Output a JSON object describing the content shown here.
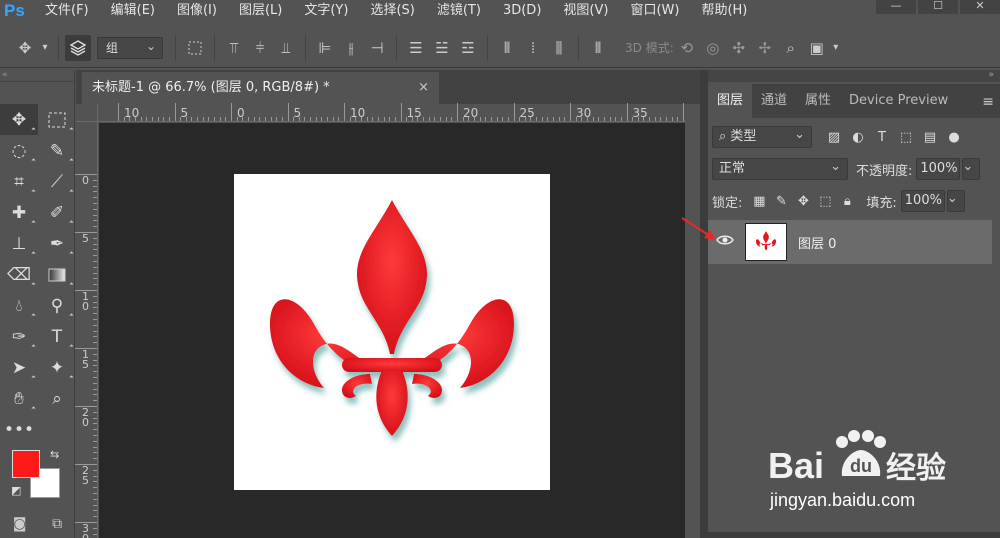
{
  "app": {
    "logo": "Ps",
    "menu": [
      "文件(F)",
      "编辑(E)",
      "图像(I)",
      "图层(L)",
      "文字(Y)",
      "选择(S)",
      "滤镜(T)",
      "3D(D)",
      "视图(V)",
      "窗口(W)",
      "帮助(H)"
    ]
  },
  "options_bar": {
    "auto_select_value": "组",
    "mode_3d_label": "3D 模式:"
  },
  "document": {
    "tab_title": "未标题-1 @ 66.7% (图层 0, RGB/8#) *",
    "close_glyph": "×",
    "ruler_h": [
      "10",
      "5",
      "0",
      "5",
      "10",
      "15",
      "20",
      "25",
      "30",
      "35"
    ],
    "ruler_v": [
      "0",
      "5",
      "10",
      "15",
      "20",
      "25",
      "30"
    ]
  },
  "colors": {
    "foreground": "#ff1a1a",
    "background": "#ffffff",
    "accent_blue": "#31a8ff",
    "fleur_red": "#e8141c"
  },
  "layers_panel": {
    "tabs": [
      "图层",
      "通道",
      "属性",
      "Device Preview"
    ],
    "filter_label": "类型",
    "blend_mode": "正常",
    "opacity_label": "不透明度:",
    "opacity_value": "100%",
    "lock_label": "锁定:",
    "fill_label": "填充:",
    "fill_value": "100%",
    "layers": [
      {
        "name": "图层 0",
        "visible": true
      }
    ]
  },
  "watermark": {
    "brand_text": "Bai 经验",
    "url": "jingyan.baidu.com"
  }
}
